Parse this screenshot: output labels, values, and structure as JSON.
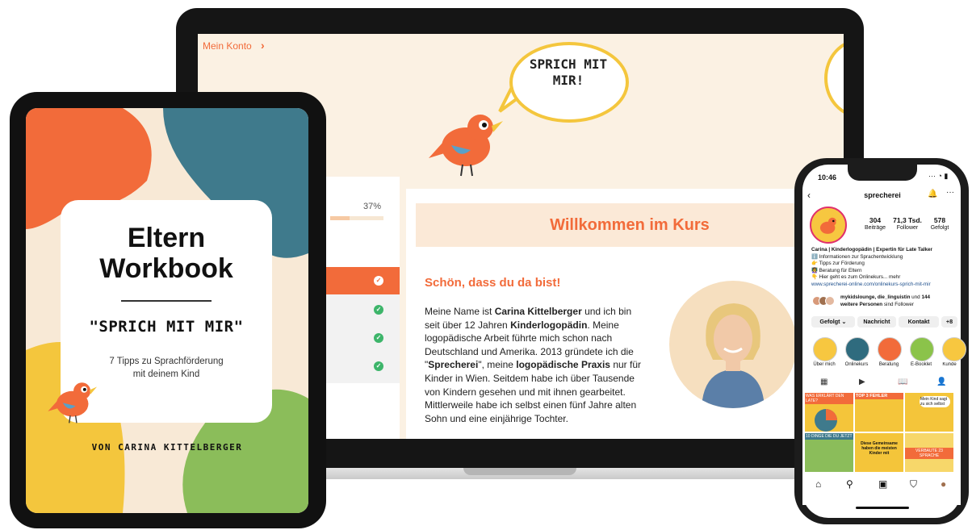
{
  "laptop": {
    "breadcrumb": "Mein Konto",
    "breadcrumb_chevron": "›",
    "speech_bubble": "SPRICH MIT MIR!",
    "progress_percent": "37%",
    "progress_value": 0.37,
    "nav_checks": [
      "✓",
      "✓",
      "✓",
      "✓"
    ],
    "welcome_title": "Willkommen im Kurs",
    "subhead": "Schön, dass du da bist!",
    "body_parts": [
      "Meine Name ist ",
      "Carina Kittelberger",
      " und ich bin seit über 12 Jahren ",
      "Kinderlogopädin",
      ". Meine logopädische Arbeit führte mich schon nach Deutschland und Amerika. 2013 gründete ich die \"",
      "Sprecherei",
      "\", meine ",
      "logopädische Praxis",
      " nur für Kinder in Wien. Seitdem habe ich über Tausende von Kindern gesehen und mit ihnen gearbeitet. Mittlerweile habe ich selbst einen fünf Jahre alten Sohn und eine einjährige Tochter."
    ]
  },
  "tablet": {
    "title_line1": "Eltern",
    "title_line2": "Workbook",
    "subtitle": "\"SPRICH MIT MIR\"",
    "description_line1": "7 Tipps zu Sprachförderung",
    "description_line2": "mit deinem Kind",
    "author": "VON CARINA KITTELBERGER"
  },
  "phone": {
    "time": "10:46",
    "status_icons": "··· ◔ ▮",
    "back": "‹",
    "username": "sprecherei",
    "bell": "🔔",
    "more": "···",
    "stats": [
      {
        "value": "304",
        "label": "Beiträge"
      },
      {
        "value": "71,3 Tsd.",
        "label": "Follower"
      },
      {
        "value": "578",
        "label": "Gefolgt"
      }
    ],
    "bio_name": "Carina | Kinderlogopädin | Expertin für Late Talker",
    "bio_lines": [
      "ℹ️ Informationen zur Sprachentwicklung",
      "👉 Tipps zur Förderung",
      "👩‍🏫 Beratung für Eltern",
      "👇 Hier geht es zum Onlinekurs... mehr"
    ],
    "bio_link": "www.sprecherei-online.com/onlinekurs-sprich-mit-mir",
    "followed_by_bold": "mykidslounge, die_linguistin",
    "followed_by_mid": " und ",
    "followed_by_count": "144",
    "followed_by_line2_bold": "weitere Personen",
    "followed_by_line2": " sind Follower",
    "buttons": [
      "Gefolgt ⌄",
      "Nachricht",
      "Kontakt",
      "+⁠8"
    ],
    "highlights": [
      {
        "label": "Über mich",
        "color": "#f7c740"
      },
      {
        "label": "Onlinekurs",
        "color": "#2f6b7e"
      },
      {
        "label": "Beratung",
        "color": "#f26b3a"
      },
      {
        "label": "E-Booklet",
        "color": "#8bc34a"
      },
      {
        "label": "Kunde",
        "color": "#f7c740"
      }
    ],
    "tabs": [
      "▦",
      "▶",
      "📖",
      "👤"
    ],
    "tile_texts": [
      "WAS ERKLÄRT DEN LATE?",
      "TOP 3 FEHLER",
      "Mein Kind sagt zu sich selbst",
      "10 DINGE DIE DU JETZT",
      "Diese Gemeinsame haben die meisten Kinder mit",
      "VERBAUTE 23 SPRACHE"
    ],
    "bottom_nav": [
      "⌂",
      "⚲",
      "▣",
      "⛉",
      "●"
    ]
  },
  "colors": {
    "orange": "#f26b3a",
    "yellow": "#f4c63d",
    "cream": "#fbf1e3",
    "teal": "#3f7a8c",
    "green": "#8bbd5a",
    "instagram_pink": "#e1306c"
  }
}
